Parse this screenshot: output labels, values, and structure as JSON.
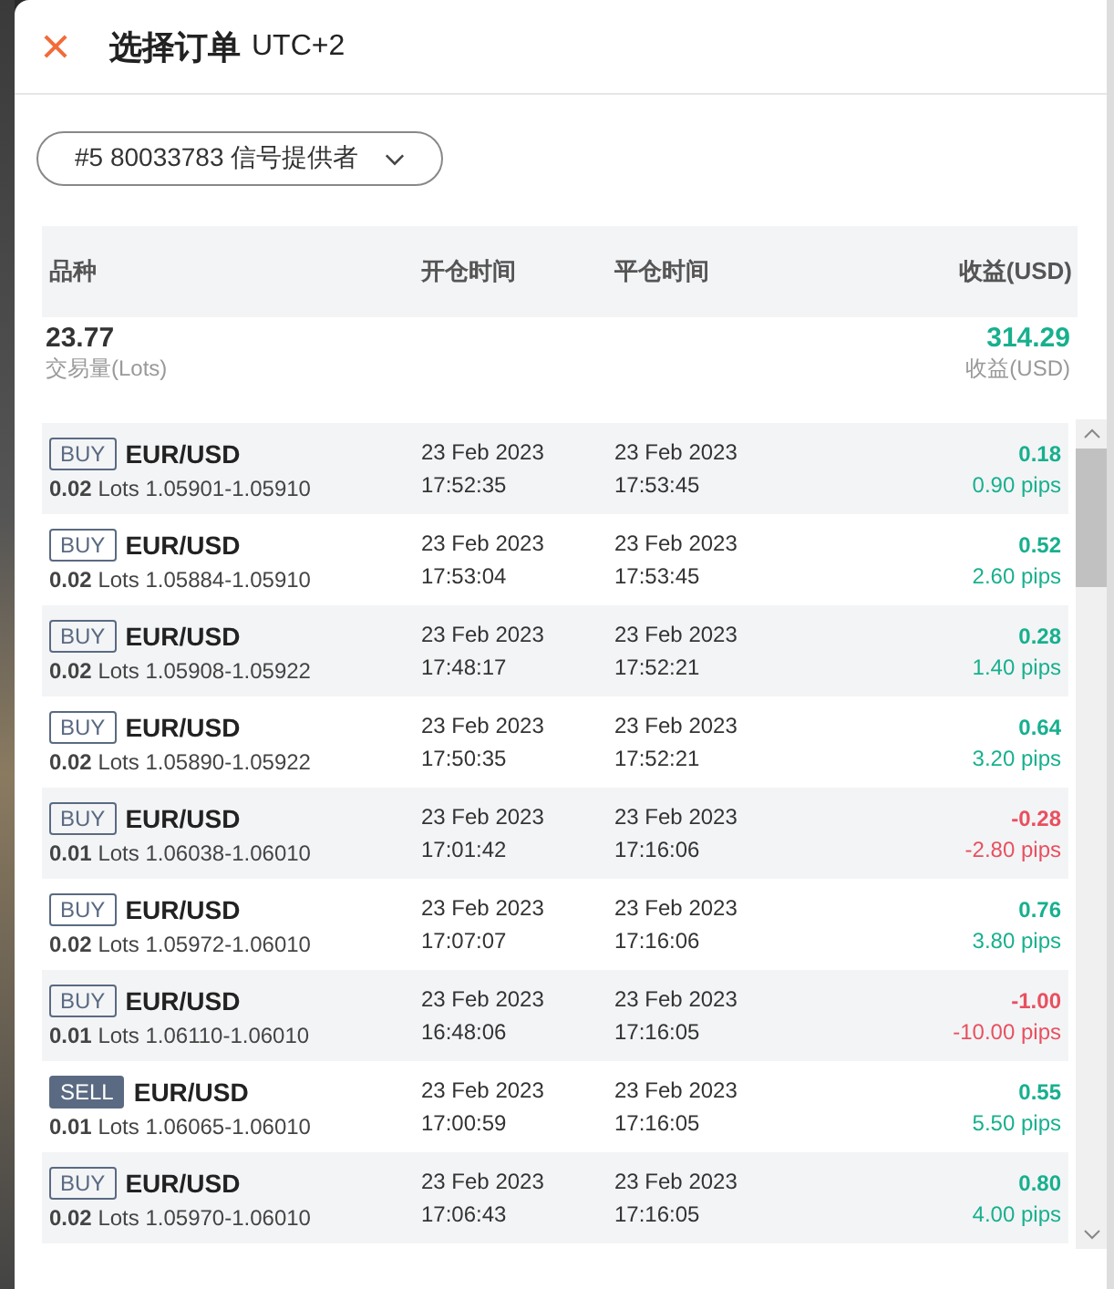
{
  "dialog": {
    "title": "选择订单",
    "timezone": "UTC+2"
  },
  "account_select": {
    "value": "#5 80033783 信号提供者"
  },
  "table": {
    "columns": [
      "品种",
      "开仓时间",
      "平仓时间",
      "收益(USD)"
    ],
    "summary": {
      "volume": "23.77",
      "volume_label": "交易量(Lots)",
      "profit": "314.29",
      "profit_label": "收益(USD)"
    },
    "rows": [
      {
        "side": "BUY",
        "filled": false,
        "symbol": "EUR/USD",
        "detail": "**0.02** Lots 1.05901-1.05910",
        "open_date": "23 Feb 2023",
        "open_time": "17:52:35",
        "close_date": "23 Feb 2023",
        "close_time": "17:53:45",
        "profit": "0.18",
        "pips": "0.90 pips",
        "negative": false
      },
      {
        "side": "BUY",
        "filled": false,
        "symbol": "EUR/USD",
        "detail": "**0.02** Lots 1.05884-1.05910",
        "open_date": "23 Feb 2023",
        "open_time": "17:53:04",
        "close_date": "23 Feb 2023",
        "close_time": "17:53:45",
        "profit": "0.52",
        "pips": "2.60 pips",
        "negative": false
      },
      {
        "side": "BUY",
        "filled": false,
        "symbol": "EUR/USD",
        "detail": "**0.02** Lots 1.05908-1.05922",
        "open_date": "23 Feb 2023",
        "open_time": "17:48:17",
        "close_date": "23 Feb 2023",
        "close_time": "17:52:21",
        "profit": "0.28",
        "pips": "1.40 pips",
        "negative": false
      },
      {
        "side": "BUY",
        "filled": false,
        "symbol": "EUR/USD",
        "detail": "**0.02** Lots 1.05890-1.05922",
        "open_date": "23 Feb 2023",
        "open_time": "17:50:35",
        "close_date": "23 Feb 2023",
        "close_time": "17:52:21",
        "profit": "0.64",
        "pips": "3.20 pips",
        "negative": false
      },
      {
        "side": "BUY",
        "filled": false,
        "symbol": "EUR/USD",
        "detail": "**0.01** Lots 1.06038-1.06010",
        "open_date": "23 Feb 2023",
        "open_time": "17:01:42",
        "close_date": "23 Feb 2023",
        "close_time": "17:16:06",
        "profit": "-0.28",
        "pips": "-2.80 pips",
        "negative": true
      },
      {
        "side": "BUY",
        "filled": false,
        "symbol": "EUR/USD",
        "detail": "**0.02** Lots 1.05972-1.06010",
        "open_date": "23 Feb 2023",
        "open_time": "17:07:07",
        "close_date": "23 Feb 2023",
        "close_time": "17:16:06",
        "profit": "0.76",
        "pips": "3.80 pips",
        "negative": false
      },
      {
        "side": "BUY",
        "filled": false,
        "symbol": "EUR/USD",
        "detail": "**0.01** Lots 1.06110-1.06010",
        "open_date": "23 Feb 2023",
        "open_time": "16:48:06",
        "close_date": "23 Feb 2023",
        "close_time": "17:16:05",
        "profit": "-1.00",
        "pips": "-10.00 pips",
        "negative": true
      },
      {
        "side": "SELL",
        "filled": true,
        "symbol": "EUR/USD",
        "detail": "**0.01** Lots 1.06065-1.06010",
        "open_date": "23 Feb 2023",
        "open_time": "17:00:59",
        "close_date": "23 Feb 2023",
        "close_time": "17:16:05",
        "profit": "0.55",
        "pips": "5.50 pips",
        "negative": false
      },
      {
        "side": "BUY",
        "filled": false,
        "symbol": "EUR/USD",
        "detail": "**0.02** Lots 1.05970-1.06010",
        "open_date": "23 Feb 2023",
        "open_time": "17:06:43",
        "close_date": "23 Feb 2023",
        "close_time": "17:16:05",
        "profit": "0.80",
        "pips": "4.00 pips",
        "negative": false
      }
    ]
  }
}
